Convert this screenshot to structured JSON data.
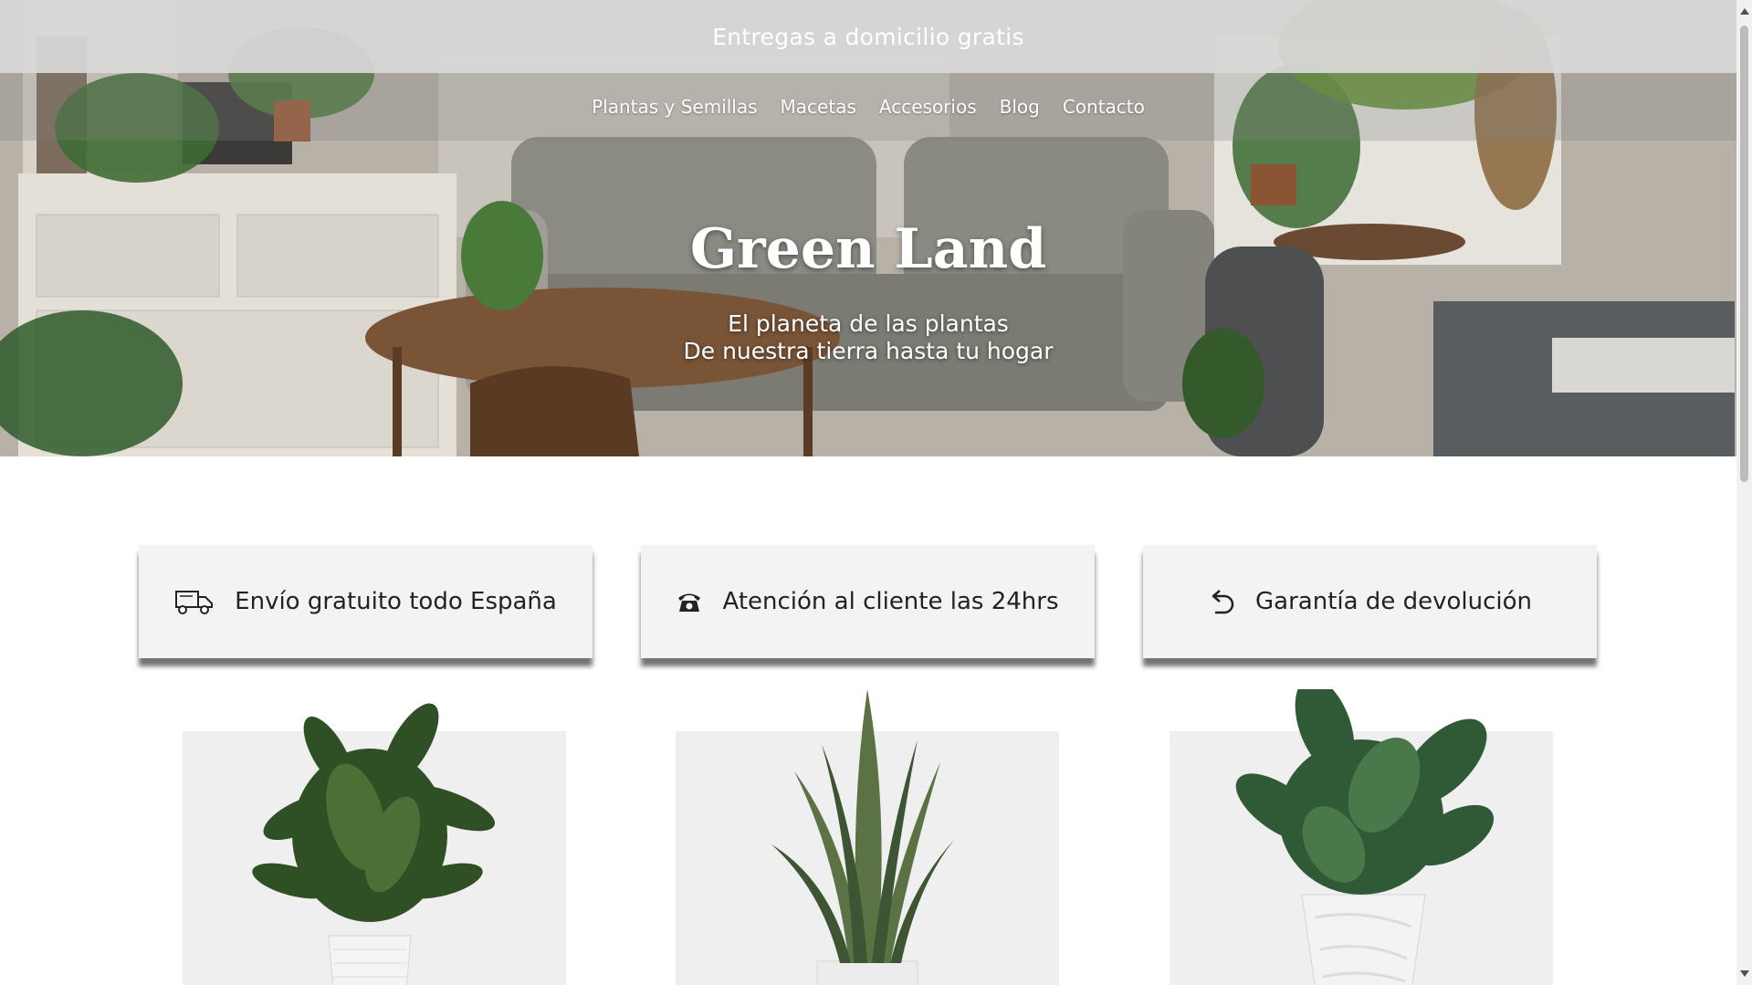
{
  "promo_bar": {
    "text": "Entregas a domicilio gratis"
  },
  "nav": {
    "items": [
      {
        "label": "Plantas y Semillas"
      },
      {
        "label": "Macetas"
      },
      {
        "label": "Accesorios"
      },
      {
        "label": "Blog"
      },
      {
        "label": "Contacto"
      }
    ]
  },
  "hero": {
    "title": "Green Land",
    "subtitle_line1": "El planeta de las plantas",
    "subtitle_line2": "De nuestra tierra hasta tu hogar"
  },
  "features": [
    {
      "icon": "truck-icon",
      "text": "Envío gratuito todo España"
    },
    {
      "icon": "phone-icon",
      "text": "Atención al cliente las 24hrs"
    },
    {
      "icon": "return-arrow-icon",
      "text": "Garantía de devolución"
    }
  ],
  "products": [
    {
      "image": "leafy-plant-white-ribbed-pot"
    },
    {
      "image": "snake-plant-white-pot"
    },
    {
      "image": "broadleaf-plant-white-wave-pot"
    }
  ],
  "colors": {
    "promo_bar_bg": "#d7d7d7",
    "feature_card_bg": "#f3f3f3",
    "product_bg": "#efefef",
    "text_dark": "#222222",
    "text_light": "#ffffff"
  }
}
